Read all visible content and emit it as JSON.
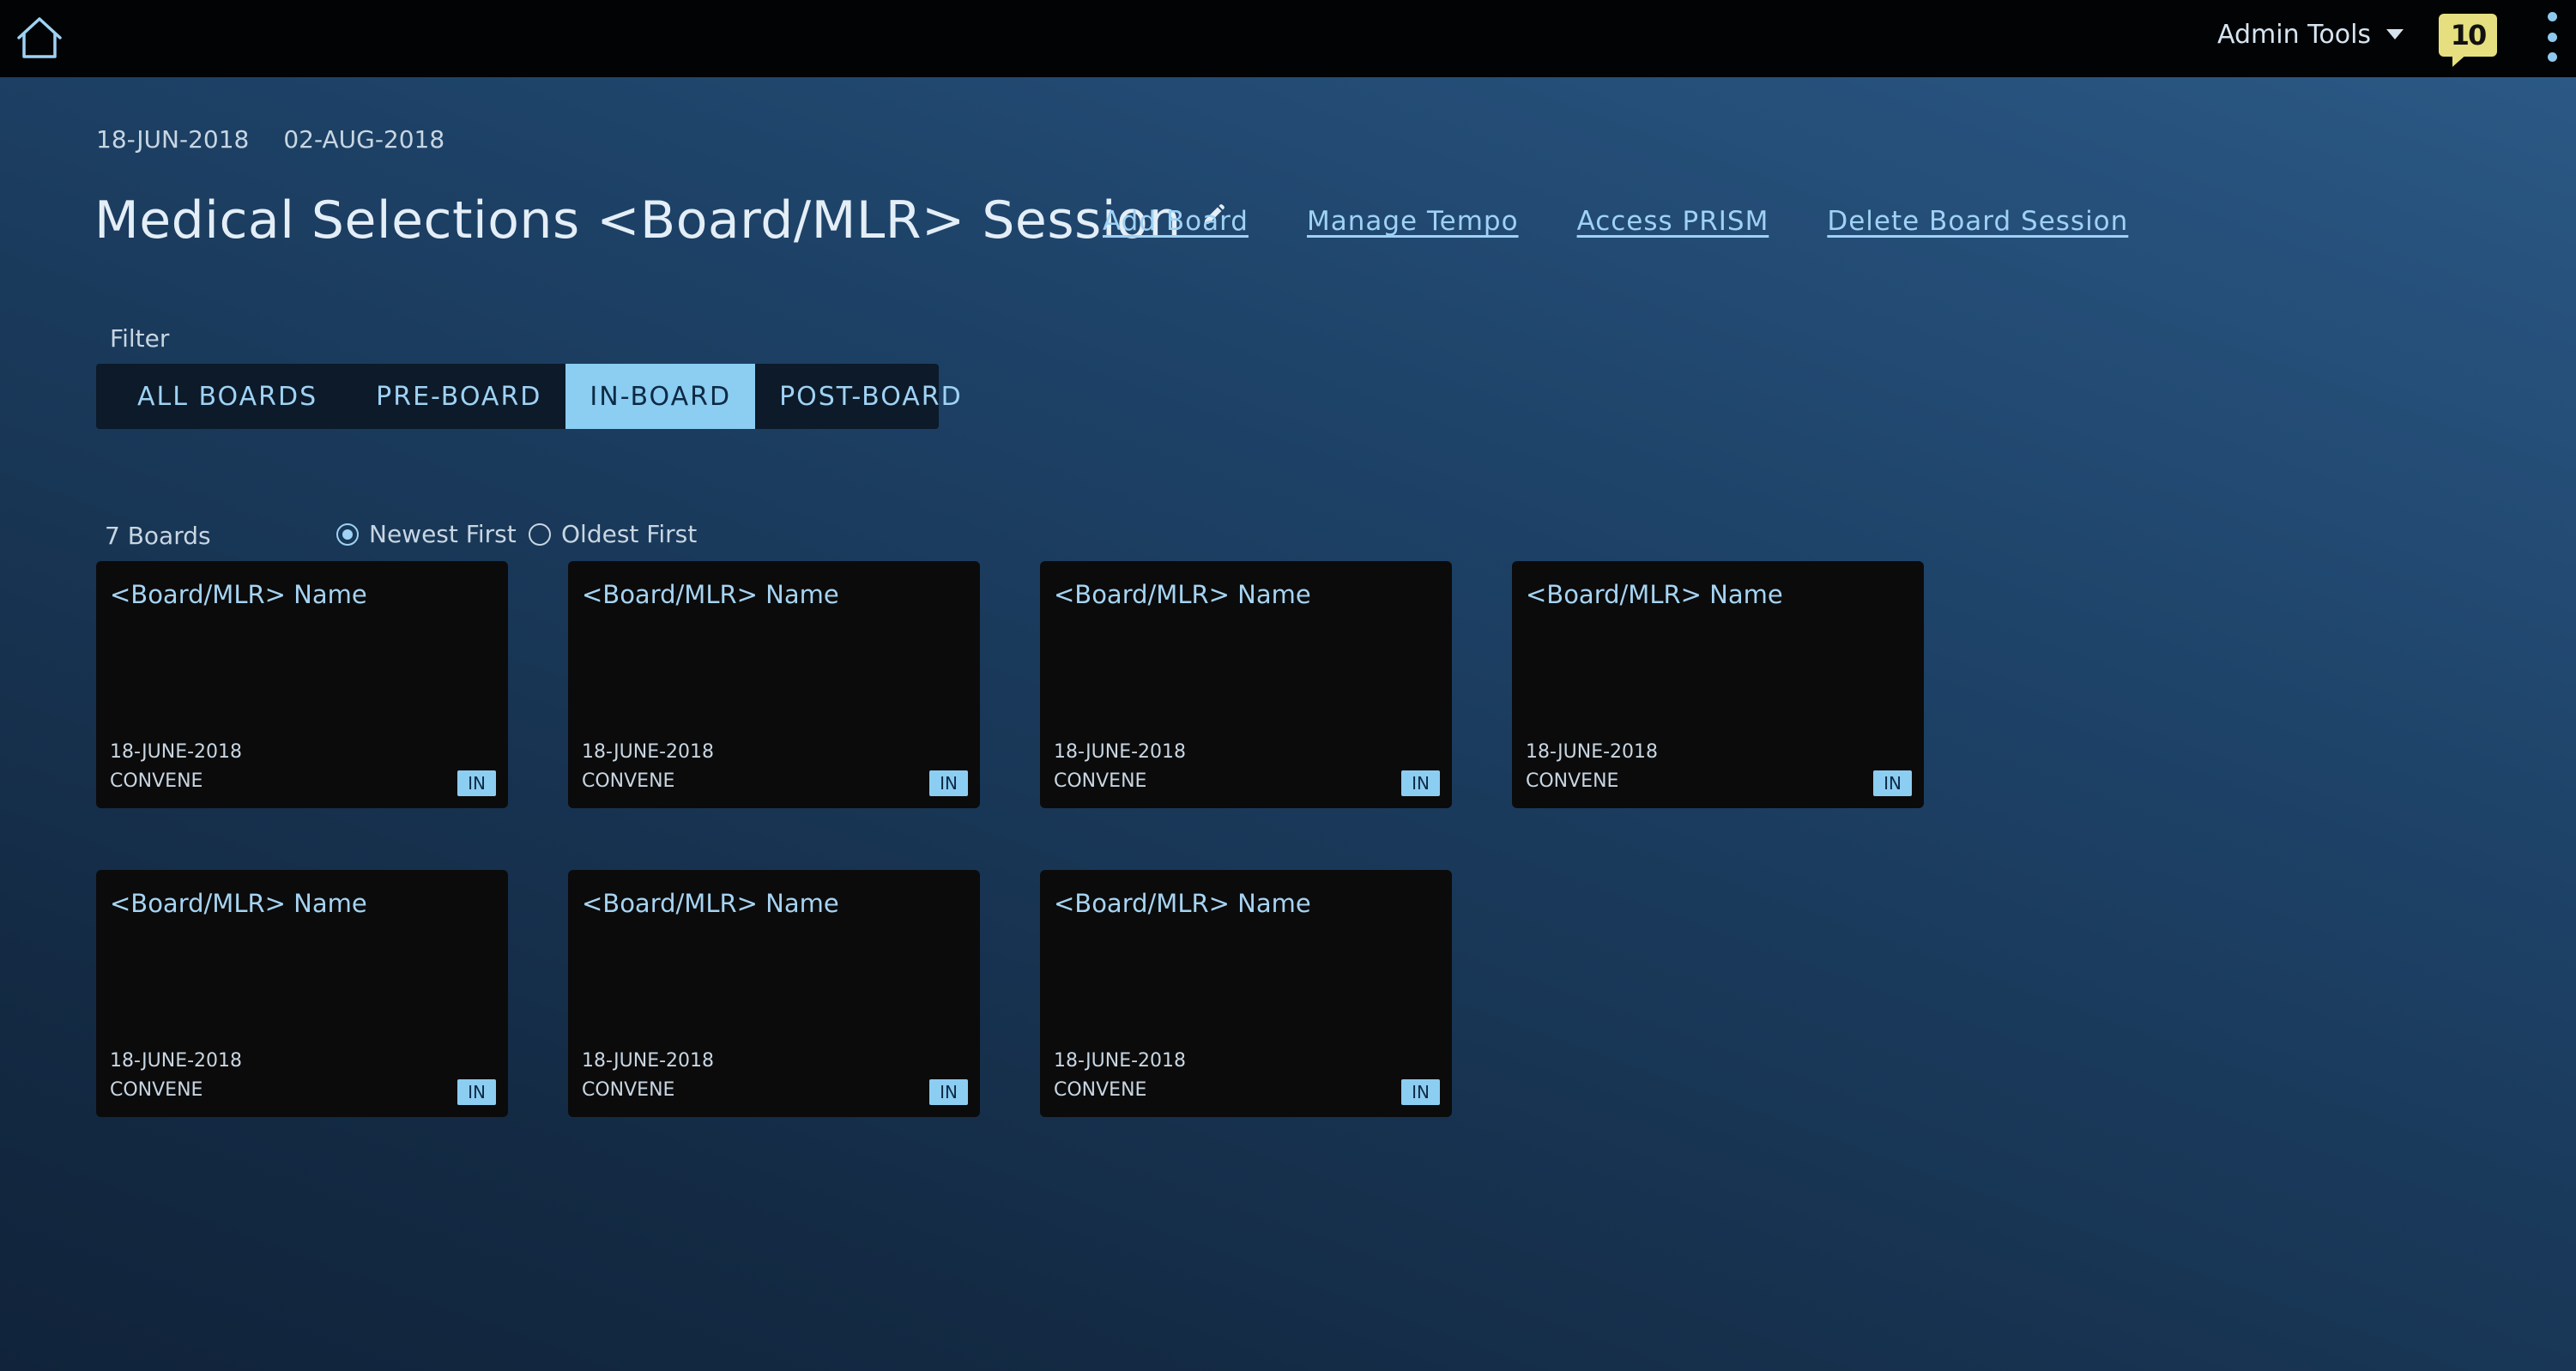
{
  "topbar": {
    "home_icon": "home-icon",
    "admin_tools_label": "Admin Tools",
    "notification_count": "10",
    "menu_icon": "kebab-icon"
  },
  "session": {
    "start_date": "18-JUN-2018",
    "end_date": "02-AUG-2018",
    "title": "Medical Selections <Board/MLR> Session"
  },
  "actions": {
    "add_board": "Add Board",
    "manage_tempo": "Manage Tempo",
    "access_prism": "Access PRISM",
    "delete_session": "Delete Board Session"
  },
  "filter": {
    "label": "Filter",
    "options": [
      "ALL BOARDS",
      "PRE-BOARD",
      "IN-BOARD",
      "POST-BOARD"
    ],
    "active": "IN-BOARD"
  },
  "list": {
    "count_label": "7 Boards",
    "sort_newest": "Newest First",
    "sort_oldest": "Oldest First",
    "sort_selected": "Newest First"
  },
  "boards": [
    {
      "name": "<Board/MLR> Name",
      "date": "18-JUNE-2018",
      "type": "CONVENE",
      "status": "IN"
    },
    {
      "name": "<Board/MLR> Name",
      "date": "18-JUNE-2018",
      "type": "CONVENE",
      "status": "IN"
    },
    {
      "name": "<Board/MLR> Name",
      "date": "18-JUNE-2018",
      "type": "CONVENE",
      "status": "IN"
    },
    {
      "name": "<Board/MLR> Name",
      "date": "18-JUNE-2018",
      "type": "CONVENE",
      "status": "IN"
    },
    {
      "name": "<Board/MLR> Name",
      "date": "18-JUNE-2018",
      "type": "CONVENE",
      "status": "IN"
    },
    {
      "name": "<Board/MLR> Name",
      "date": "18-JUNE-2018",
      "type": "CONVENE",
      "status": "IN"
    },
    {
      "name": "<Board/MLR> Name",
      "date": "18-JUNE-2018",
      "type": "CONVENE",
      "status": "IN"
    }
  ],
  "colors": {
    "accent": "#8ccdf2",
    "link": "#9fd2f4",
    "notification": "#e5df7f",
    "card_bg": "#0b0b0c",
    "topbar_bg": "#020304"
  }
}
